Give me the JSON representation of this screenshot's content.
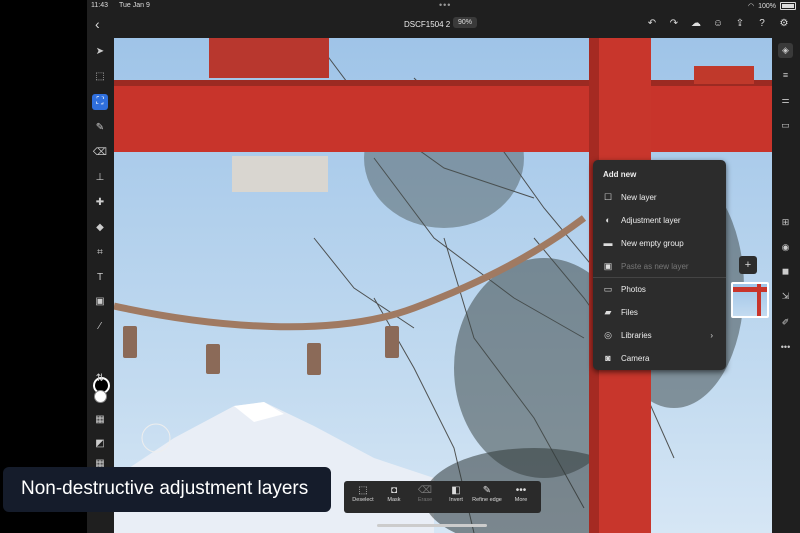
{
  "status": {
    "time": "11:43",
    "date": "Tue Jan 9",
    "battery": "100%",
    "dots": "•••"
  },
  "doc": {
    "name": "DSCF1504 2",
    "zoom": "90%"
  },
  "add_menu": {
    "title": "Add new",
    "items": [
      {
        "label": "New layer",
        "icon": "square-icon",
        "glyph": "☐",
        "disabled": false
      },
      {
        "label": "Adjustment layer",
        "icon": "adjustment-icon",
        "glyph": "◐",
        "disabled": false
      },
      {
        "label": "New empty group",
        "icon": "folder-icon",
        "glyph": "▬",
        "disabled": false
      },
      {
        "label": "Paste as new layer",
        "icon": "clipboard-icon",
        "glyph": "▣",
        "disabled": true
      },
      {
        "label": "Photos",
        "icon": "photos-icon",
        "glyph": "▭",
        "disabled": false
      },
      {
        "label": "Files",
        "icon": "files-icon",
        "glyph": "▰",
        "disabled": false
      },
      {
        "label": "Libraries",
        "icon": "libraries-icon",
        "glyph": "◎",
        "disabled": false
      },
      {
        "label": "Camera",
        "icon": "camera-icon",
        "glyph": "◙",
        "disabled": false
      }
    ]
  },
  "selection_bar": [
    {
      "label": "Deselect",
      "icon": "deselect-icon",
      "glyph": "⬚",
      "disabled": false
    },
    {
      "label": "Mask",
      "icon": "mask-icon",
      "glyph": "◘",
      "disabled": false
    },
    {
      "label": "Erase",
      "icon": "erase-icon",
      "glyph": "⌫",
      "disabled": true
    },
    {
      "label": "Invert",
      "icon": "invert-icon",
      "glyph": "◧",
      "disabled": false
    },
    {
      "label": "Refine edge",
      "icon": "refine-edge-icon",
      "glyph": "✎",
      "disabled": false
    },
    {
      "label": "More",
      "icon": "more-icon",
      "glyph": "•••",
      "disabled": false
    }
  ],
  "caption": "Non-destructive adjustment layers",
  "colors": {
    "accent": "#2f6fdd",
    "torii": "#c8342b",
    "sky": "#9fc4e8"
  }
}
